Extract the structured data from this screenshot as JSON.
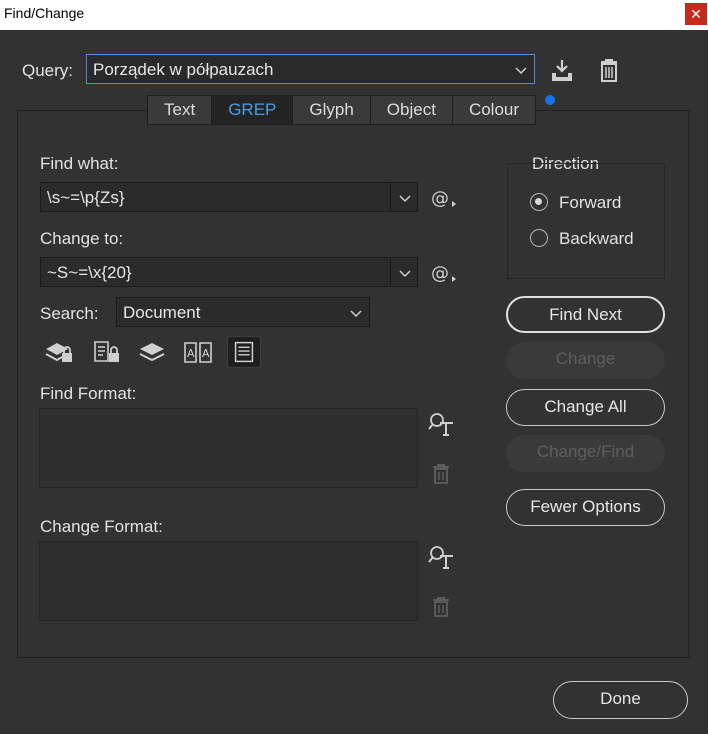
{
  "window": {
    "title": "Find/Change",
    "close_glyph": "✕"
  },
  "query": {
    "label": "Query:",
    "value": "Porządek w półpauzach"
  },
  "tabs": [
    "Text",
    "GREP",
    "Glyph",
    "Object",
    "Colour"
  ],
  "active_tab": "GREP",
  "find_what": {
    "label": "Find what:",
    "value": "\\s~=\\p{Zs}"
  },
  "change_to": {
    "label": "Change to:",
    "value": "~S~=\\x{20}"
  },
  "search": {
    "label": "Search:",
    "value": "Document"
  },
  "find_format": {
    "label": "Find Format:"
  },
  "change_format": {
    "label": "Change Format:"
  },
  "direction": {
    "label": "Direction",
    "forward": "Forward",
    "backward": "Backward",
    "selected": "Forward"
  },
  "buttons": {
    "find_next": "Find Next",
    "change": "Change",
    "change_all": "Change All",
    "change_find": "Change/Find",
    "fewer_options": "Fewer Options",
    "done": "Done"
  },
  "colors": {
    "accent": "#4b9ce8",
    "query_border": "#4a90d9",
    "dot": "#1473e6",
    "bg": "#323232"
  },
  "icons": [
    "save-query-icon",
    "delete-query-icon",
    "special-chars-icon",
    "locked-layers-icon",
    "locked-stories-icon",
    "hidden-layers-icon",
    "master-pages-icon",
    "footnotes-icon",
    "specify-format-icon",
    "clear-format-icon"
  ]
}
